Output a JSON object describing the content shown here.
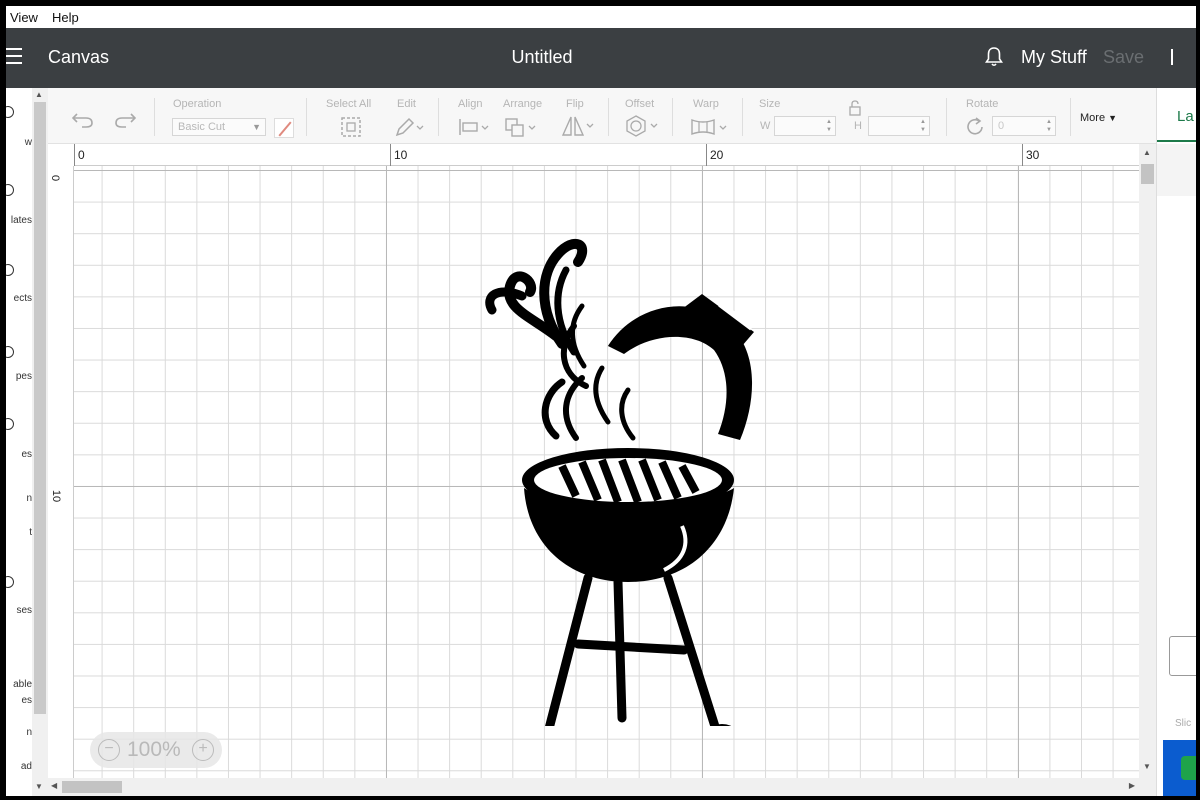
{
  "menu": {
    "view": "View",
    "help": "Help"
  },
  "header": {
    "app_title": "Canvas",
    "doc_title": "Untitled",
    "my_stuff": "My Stuff",
    "save": "Save"
  },
  "leftnav": {
    "items": [
      "w",
      "lates",
      "ects",
      "pes",
      "es",
      "n",
      "t",
      "ses",
      "able",
      "es",
      "n",
      "ad"
    ]
  },
  "toolbar": {
    "operation_label": "Operation",
    "operation_value": "Basic Cut",
    "select_all": "Select All",
    "edit": "Edit",
    "align": "Align",
    "arrange": "Arrange",
    "flip": "Flip",
    "offset": "Offset",
    "warp": "Warp",
    "size": "Size",
    "w": "W",
    "h": "H",
    "rotate": "Rotate",
    "rotate_value": "0",
    "more": "More"
  },
  "ruler": {
    "top": [
      "0",
      "10",
      "20",
      "30"
    ],
    "left": [
      "0",
      "10"
    ]
  },
  "zoom": {
    "value": "100%"
  },
  "rightpanel": {
    "tab": "La",
    "slice": "Slic"
  },
  "colors": {
    "header_bg": "#3b3f42",
    "accent_green": "#1d7a4a",
    "accent_blue": "#0b5ccf"
  },
  "icons": [
    "hamburger-icon",
    "bell-icon",
    "undo-icon",
    "redo-icon",
    "pen-icon",
    "select-all-icon",
    "edit-icon",
    "align-icon",
    "arrange-icon",
    "flip-icon",
    "offset-icon",
    "warp-icon",
    "lock-icon",
    "rotate-icon",
    "zoom-out-icon",
    "zoom-in-icon"
  ]
}
